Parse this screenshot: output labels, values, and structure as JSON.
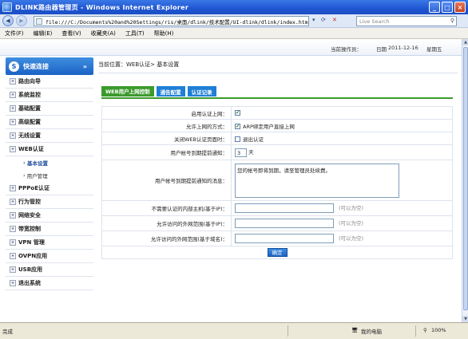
{
  "window": {
    "title": "DLINK路由器管理页 - Windows Internet Explorer"
  },
  "address": {
    "url": "file:///C:/Documents%20and%20Settings/ris/桌面/dlink/技术配置/UI-dlink/dlink/index.htm#",
    "search_placeholder": "Live Search"
  },
  "menu": [
    "文件(F)",
    "编辑(E)",
    "查看(V)",
    "收藏夹(A)",
    "工具(T)",
    "帮助(H)"
  ],
  "info": {
    "operator": "当前操作员：",
    "date_label": "日期",
    "date": "2011-12-16",
    "weekday": "星期五"
  },
  "sidebar": {
    "header": "快速连接",
    "items_top": [
      "路由向导",
      "系统监控",
      "基础配置",
      "高级配置",
      "无线设置",
      "WEB认证"
    ],
    "sub_items": [
      "基本设置",
      "用户管理"
    ],
    "items_bottom": [
      "PPPoE认证",
      "行为管控",
      "网络安全",
      "带宽控制",
      "VPN 管理",
      "OVPN应用",
      "USB应用",
      "退出系统"
    ]
  },
  "breadcrumb": "当前位置：WEB认证> 基本设置",
  "tabs": [
    "WEB用户上网控制",
    "通告配置",
    "认证记录"
  ],
  "form": {
    "enable_label": "启用认证上网：",
    "method_label": "允许上网的方式：",
    "method_option": "ARP绑定用户直接上网",
    "close_page_label": "关闭WEB认证页面时：",
    "logout_option": "退出认证",
    "notify_days_label": "用户帐号到期提前通知：",
    "notify_days": "3",
    "days_unit": "天",
    "notify_msg_label": "用户帐号到期提前通知的消息：",
    "notify_msg": "您的帐号即将到期，请至管理员处续费。",
    "no_auth_hosts_label": "不需要认证的内部主机(基于IP)：",
    "allowed_ip_label": "允许访问的外网范围(基于IP)：",
    "allowed_domain_label": "允许访问的外网范围(基于域名)：",
    "empty_hint": "(可以为空)",
    "ok_button": "确定"
  },
  "status": {
    "left": "完成",
    "zone": "我的电脑",
    "zoom": "100%"
  }
}
